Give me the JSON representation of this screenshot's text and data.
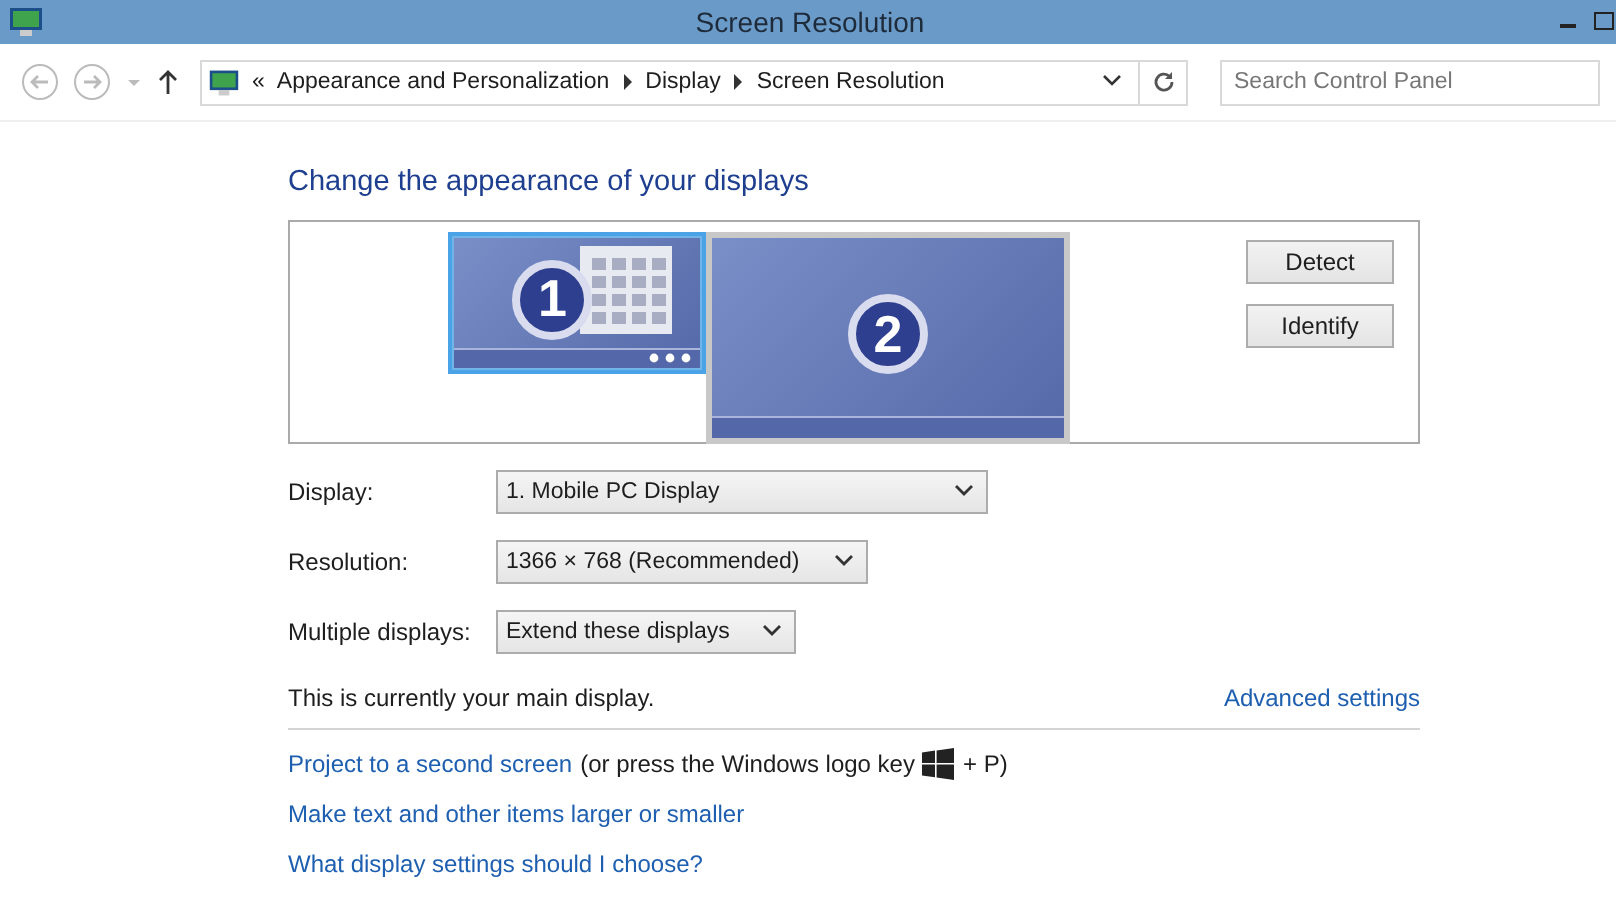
{
  "window": {
    "title": "Screen Resolution"
  },
  "address_bar": {
    "overflow": "«",
    "crumbs": [
      "Appearance and Personalization",
      "Display",
      "Screen Resolution"
    ]
  },
  "search": {
    "placeholder": "Search Control Panel"
  },
  "heading": "Change the appearance of your displays",
  "monitors": [
    {
      "number": "1",
      "selected": true
    },
    {
      "number": "2",
      "selected": false
    }
  ],
  "buttons": [
    "Detect",
    "Identify"
  ],
  "settings": [
    {
      "label": "Display:",
      "value": "1. Mobile PC Display"
    },
    {
      "label": "Resolution:",
      "value": "1366 × 768 (Recommended)"
    },
    {
      "label": "Multiple displays:",
      "value": "Extend these displays"
    }
  ],
  "main_note": "This is currently your main display.",
  "advanced_link": "Advanced settings",
  "project": {
    "link": "Project to a second screen",
    "note_before": "(or press the Windows logo key",
    "note_after": "+ P)"
  },
  "links": [
    "Make text and other items larger or smaller",
    "What display settings should I choose?"
  ]
}
